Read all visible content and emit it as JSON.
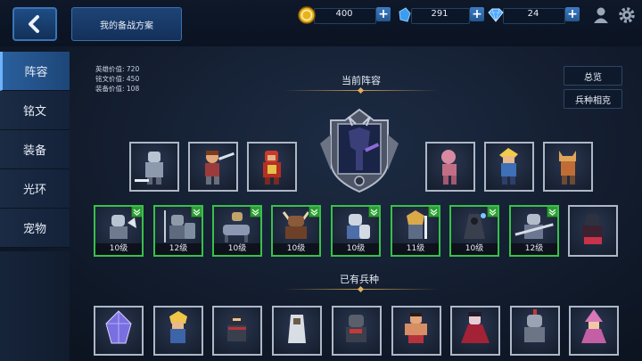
{
  "topbar": {
    "plan_label": "我的备战方案",
    "currencies": [
      {
        "name": "gold",
        "value": "400",
        "color": "#f2c230"
      },
      {
        "name": "crystal",
        "value": "291",
        "color": "#3b9cf0"
      },
      {
        "name": "diamond",
        "value": "24",
        "color": "#4aa6ff"
      }
    ]
  },
  "sidebar": {
    "items": [
      {
        "label": "阵容",
        "active": true
      },
      {
        "label": "铭文",
        "active": false
      },
      {
        "label": "装备",
        "active": false
      },
      {
        "label": "光环",
        "active": false
      },
      {
        "label": "宠物",
        "active": false
      }
    ]
  },
  "stats": {
    "hero_value": "英雄价值: 720",
    "rune_value": "铭文价值: 450",
    "equip_value": "装备价值: 108"
  },
  "lineup": {
    "title": "当前阵容",
    "overview_label": "总览",
    "counter_label": "兵种相克",
    "top_units": [
      "knight",
      "swordsman",
      "red-warrior",
      "pink-rogue",
      "blonde-fighter",
      "cat-warrior"
    ],
    "hero": "dark-armored-hero"
  },
  "troops": {
    "levels": [
      "10级",
      "12级",
      "10级",
      "10级",
      "10级",
      "11级",
      "10级",
      "12级"
    ],
    "units": [
      "axe-knight",
      "spearman",
      "cavalry",
      "horned-warrior",
      "shield-guard",
      "swordmaster",
      "hooded-mage",
      "lancer",
      "shadow-knight"
    ]
  },
  "owned": {
    "title": "已有兵种",
    "units": [
      "crystal-golem",
      "blonde-archer",
      "ninja",
      "white-hood",
      "dark-knight",
      "brawler",
      "vampire",
      "armored-knight",
      "pink-witch"
    ]
  }
}
